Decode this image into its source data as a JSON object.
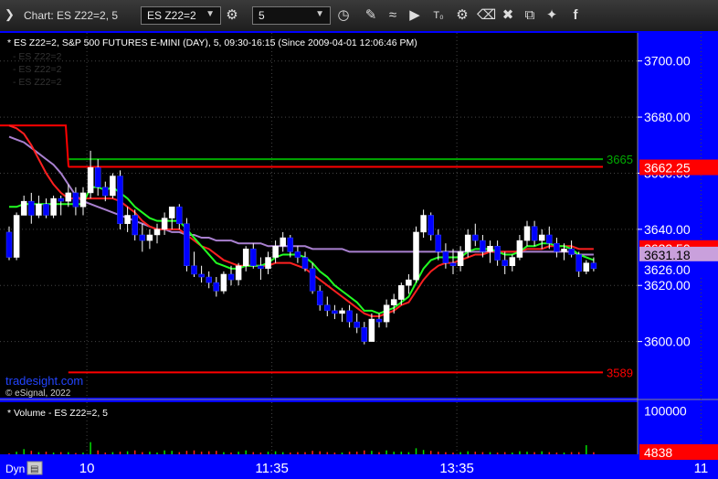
{
  "window": {
    "title": "Chart: ES Z22=2, 5",
    "symbol_value": "ES Z22=2",
    "interval_value": "5"
  },
  "toolbar_icons": [
    "settings-gear-icon",
    "clock-icon",
    "pencil-icon",
    "indicator-icon",
    "play-icon",
    "text-tool-icon",
    "eraser-icon",
    "copy-icon",
    "twitter-icon",
    "facebook-icon"
  ],
  "header": {
    "study_line": "* ES Z22=2, S&P 500 FUTURES E-MINI (DAY), 5, 09:30-16:15 (Since 2009-04-01 12:06:46 PM)",
    "faded_lines": [
      "- ES Z22=2",
      "- ES Z22=2",
      "- ES Z22=2"
    ],
    "watermark": "tradesight.com",
    "copyright": "© eSignal, 2022",
    "volume_title": "* Volume - ES Z22=2, 5"
  },
  "colors": {
    "bull": "#ffffff",
    "bear": "#0000ff",
    "level_red": "#ff0000",
    "level_green": "#00aa00",
    "sma_purple": "#a980d0",
    "ema_red": "#ff2020",
    "ema_green": "#22ff22",
    "axis_bg": "#0000ff",
    "chart_bg": "#000000"
  },
  "chart_data": {
    "type": "candlestick",
    "ylim": [
      3580,
      3710
    ],
    "y_ticks": [
      "3700.00",
      "3680.00",
      "3660.00",
      "3640.00",
      "3620.00",
      "3600.00"
    ],
    "y_tick_values": [
      3700,
      3680,
      3660,
      3640,
      3620,
      3600
    ],
    "x_ticks": [
      "10",
      "11:35",
      "13:35",
      "11"
    ],
    "x_tick_bar_index": [
      11,
      36,
      61,
      94
    ],
    "level_labels": [
      {
        "text": "3665",
        "value": 3665,
        "color": "#00aa00"
      },
      {
        "text": "3589",
        "value": 3589,
        "color": "#ff0000"
      }
    ],
    "axis_badges": [
      {
        "text": "3662.25",
        "value": 3662.25,
        "bg": "#ff0000",
        "fg": "#ffffff"
      },
      {
        "text": "3633.50",
        "value": 3633.5,
        "bg": "#ff0000",
        "fg": "#ffffff"
      },
      {
        "text": "3631.18",
        "value": 3631.18,
        "bg": "#c9a0dc",
        "fg": "#000000"
      },
      {
        "text": "3626.00",
        "value": 3626.0,
        "bg": "#0000ff",
        "fg": "#ffffff"
      }
    ],
    "levels": [
      {
        "name": "upper-red",
        "value": 3662.25,
        "color": "#ff0000"
      },
      {
        "name": "upper-green",
        "value": 3665,
        "color": "#00aa00"
      },
      {
        "name": "lower-red",
        "value": 3589,
        "color": "#ff0000"
      }
    ],
    "candles": [
      [
        3639,
        3641,
        3629,
        3630
      ],
      [
        3630,
        3646,
        3629,
        3645
      ],
      [
        3645,
        3652,
        3645,
        3650
      ],
      [
        3650,
        3653,
        3642,
        3645
      ],
      [
        3645,
        3652,
        3644,
        3649
      ],
      [
        3649,
        3651,
        3644,
        3645
      ],
      [
        3645,
        3652,
        3644,
        3651
      ],
      [
        3651,
        3652,
        3645,
        3650
      ],
      [
        3650,
        3656,
        3648,
        3653
      ],
      [
        3653,
        3655,
        3645,
        3648
      ],
      [
        3648,
        3655,
        3645,
        3653
      ],
      [
        3653,
        3668,
        3651,
        3662
      ],
      [
        3662,
        3665,
        3652,
        3655
      ],
      [
        3655,
        3657,
        3650,
        3652
      ],
      [
        3652,
        3660,
        3651,
        3659
      ],
      [
        3659,
        3661,
        3640,
        3642
      ],
      [
        3642,
        3648,
        3639,
        3645
      ],
      [
        3645,
        3647,
        3636,
        3638
      ],
      [
        3638,
        3642,
        3632,
        3636
      ],
      [
        3636,
        3640,
        3633,
        3638
      ],
      [
        3638,
        3642,
        3635,
        3640
      ],
      [
        3640,
        3646,
        3638,
        3644
      ],
      [
        3644,
        3648,
        3640,
        3648
      ],
      [
        3648,
        3649,
        3640,
        3642
      ],
      [
        3642,
        3644,
        3625,
        3627
      ],
      [
        3627,
        3632,
        3623,
        3624
      ],
      [
        3624,
        3627,
        3621,
        3623
      ],
      [
        3623,
        3625,
        3619,
        3621
      ],
      [
        3621,
        3623,
        3616,
        3618
      ],
      [
        3618,
        3625,
        3617,
        3624
      ],
      [
        3624,
        3627,
        3620,
        3622
      ],
      [
        3622,
        3628,
        3620,
        3627
      ],
      [
        3627,
        3634,
        3625,
        3633
      ],
      [
        3633,
        3635,
        3626,
        3627
      ],
      [
        3627,
        3630,
        3622,
        3626
      ],
      [
        3626,
        3632,
        3624,
        3630
      ],
      [
        3630,
        3636,
        3628,
        3634
      ],
      [
        3634,
        3639,
        3632,
        3637
      ],
      [
        3637,
        3638,
        3630,
        3632
      ],
      [
        3632,
        3634,
        3628,
        3630
      ],
      [
        3630,
        3632,
        3625,
        3626
      ],
      [
        3626,
        3628,
        3617,
        3618
      ],
      [
        3618,
        3620,
        3611,
        3613
      ],
      [
        3613,
        3616,
        3609,
        3611
      ],
      [
        3611,
        3613,
        3608,
        3610
      ],
      [
        3610,
        3612,
        3607,
        3611
      ],
      [
        3611,
        3613,
        3605,
        3607
      ],
      [
        3607,
        3610,
        3603,
        3605
      ],
      [
        3605,
        3607,
        3599,
        3600
      ],
      [
        3600,
        3610,
        3600,
        3608
      ],
      [
        3608,
        3610,
        3605,
        3607
      ],
      [
        3607,
        3615,
        3605,
        3613
      ],
      [
        3613,
        3617,
        3610,
        3615
      ],
      [
        3615,
        3621,
        3613,
        3620
      ],
      [
        3620,
        3624,
        3617,
        3622
      ],
      [
        3622,
        3641,
        3621,
        3639
      ],
      [
        3639,
        3647,
        3637,
        3645
      ],
      [
        3645,
        3646,
        3636,
        3638
      ],
      [
        3638,
        3640,
        3629,
        3632
      ],
      [
        3632,
        3635,
        3626,
        3628
      ],
      [
        3628,
        3633,
        3624,
        3627
      ],
      [
        3627,
        3634,
        3625,
        3632
      ],
      [
        3632,
        3640,
        3630,
        3638
      ],
      [
        3638,
        3642,
        3634,
        3636
      ],
      [
        3636,
        3638,
        3630,
        3632
      ],
      [
        3632,
        3636,
        3628,
        3634
      ],
      [
        3634,
        3636,
        3627,
        3629
      ],
      [
        3629,
        3632,
        3624,
        3627
      ],
      [
        3627,
        3631,
        3625,
        3630
      ],
      [
        3630,
        3638,
        3629,
        3636
      ],
      [
        3636,
        3643,
        3634,
        3641
      ],
      [
        3641,
        3643,
        3634,
        3636
      ],
      [
        3636,
        3640,
        3633,
        3638
      ],
      [
        3638,
        3641,
        3633,
        3635
      ],
      [
        3635,
        3637,
        3630,
        3632
      ],
      [
        3632,
        3635,
        3629,
        3633
      ],
      [
        3633,
        3636,
        3630,
        3631
      ],
      [
        3631,
        3632,
        3623,
        3625
      ],
      [
        3625,
        3629,
        3624,
        3628
      ],
      [
        3628,
        3630,
        3625,
        3626
      ]
    ],
    "sma": [
      3673,
      3672,
      3671,
      3669,
      3667,
      3665,
      3663,
      3660,
      3656,
      3652,
      3650,
      3649,
      3648,
      3647,
      3646,
      3645,
      3644,
      3643,
      3642,
      3641,
      3640,
      3640,
      3639,
      3639,
      3638,
      3638,
      3637,
      3637,
      3636,
      3636,
      3636,
      3635,
      3635,
      3635,
      3635,
      3634,
      3634,
      3634,
      3634,
      3634,
      3634,
      3633,
      3633,
      3633,
      3633,
      3633,
      3632,
      3632,
      3632,
      3632,
      3632,
      3632,
      3632,
      3632,
      3632,
      3632,
      3632,
      3632,
      3632,
      3632,
      3632,
      3632,
      3632,
      3632,
      3632,
      3632,
      3632,
      3632,
      3632,
      3632,
      3632,
      3632,
      3632,
      3632,
      3632,
      3632,
      3632,
      3631,
      3631,
      3631
    ],
    "ema": [
      3677,
      3676,
      3674,
      3670,
      3665,
      3660,
      3656,
      3653,
      3651,
      3651,
      3651,
      3651,
      3651,
      3651,
      3651,
      3650,
      3648,
      3646,
      3643,
      3641,
      3640,
      3640,
      3640,
      3640,
      3638,
      3636,
      3634,
      3633,
      3631,
      3629,
      3628,
      3627,
      3627,
      3627,
      3627,
      3627,
      3628,
      3628,
      3628,
      3627,
      3626,
      3624,
      3622,
      3620,
      3618,
      3616,
      3614,
      3612,
      3610,
      3609,
      3609,
      3610,
      3611,
      3613,
      3614,
      3618,
      3622,
      3625,
      3627,
      3628,
      3628,
      3629,
      3630,
      3631,
      3631,
      3632,
      3632,
      3632,
      3632,
      3632,
      3633,
      3633,
      3633,
      3634,
      3634,
      3634,
      3634,
      3633,
      3633,
      3633
    ],
    "ema_fast": [
      3648,
      3648,
      3649,
      3649,
      3649,
      3649,
      3649,
      3649,
      3649,
      3649,
      3649,
      3655,
      3655,
      3654,
      3655,
      3653,
      3651,
      3648,
      3646,
      3644,
      3643,
      3643,
      3643,
      3643,
      3640,
      3637,
      3634,
      3631,
      3628,
      3627,
      3626,
      3626,
      3627,
      3627,
      3627,
      3628,
      3630,
      3631,
      3631,
      3631,
      3630,
      3628,
      3625,
      3623,
      3620,
      3618,
      3616,
      3614,
      3611,
      3611,
      3610,
      3611,
      3612,
      3614,
      3616,
      3621,
      3626,
      3629,
      3630,
      3630,
      3630,
      3630,
      3632,
      3633,
      3633,
      3633,
      3632,
      3631,
      3631,
      3632,
      3634,
      3634,
      3635,
      3635,
      3634,
      3634,
      3633,
      3631,
      3630,
      3629
    ],
    "volume": {
      "ylim": [
        0,
        120000
      ],
      "y_ticks": [
        "100000"
      ],
      "y_tick_values": [
        100000
      ],
      "last_label": "4838",
      "values": [
        2000,
        6000,
        12000,
        8000,
        5000,
        6000,
        4000,
        5000,
        5000,
        3000,
        4000,
        28000,
        9000,
        4000,
        5000,
        6000,
        7000,
        9000,
        5000,
        6000,
        4000,
        9000,
        8000,
        5000,
        8000,
        9000,
        6000,
        7000,
        8000,
        5000,
        4000,
        6000,
        9000,
        5000,
        4000,
        6000,
        7000,
        5000,
        4000,
        5000,
        5000,
        8000,
        7000,
        5000,
        4000,
        4000,
        6000,
        6000,
        9000,
        8000,
        5000,
        9000,
        6000,
        6000,
        5000,
        14000,
        10000,
        8000,
        6000,
        5000,
        4000,
        5000,
        7000,
        6000,
        5000,
        5000,
        4000,
        5000,
        4000,
        7000,
        6000,
        5000,
        7000,
        5000,
        4000,
        4000,
        5000,
        5000,
        21000,
        4838
      ]
    }
  },
  "status_bar": {
    "label": "Dyn"
  }
}
